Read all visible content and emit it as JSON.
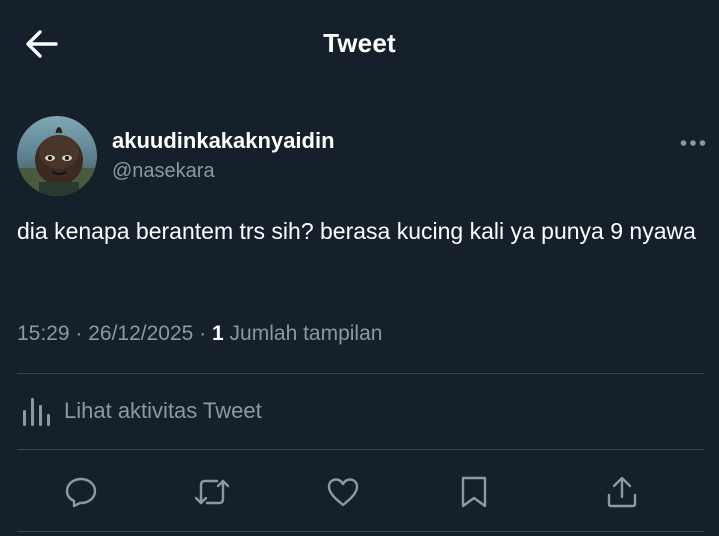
{
  "header": {
    "title": "Tweet",
    "back_icon": "arrow-left-icon"
  },
  "tweet": {
    "display_name": "akuudinkakaknyaidin",
    "username": "@nasekara",
    "text": "dia kenapa berantem trs sih? berasa kucing kali ya punya 9 nyawa",
    "time": "15:29",
    "date": "26/12/2025",
    "view_count": "1",
    "view_label": "Jumlah tampilan",
    "more_icon": "more-horizontal-icon"
  },
  "activity": {
    "label": "Lihat aktivitas Tweet",
    "icon": "bar-chart-icon"
  },
  "actions": [
    {
      "name": "reply",
      "icon": "reply-icon"
    },
    {
      "name": "retweet",
      "icon": "retweet-icon"
    },
    {
      "name": "like",
      "icon": "heart-icon"
    },
    {
      "name": "bookmark",
      "icon": "bookmark-icon"
    },
    {
      "name": "share",
      "icon": "share-icon"
    }
  ],
  "colors": {
    "background": "#15202b",
    "text_primary": "#ffffff",
    "text_secondary": "#8b98a5",
    "divider": "#38444d",
    "icon": "#8b98a5"
  }
}
